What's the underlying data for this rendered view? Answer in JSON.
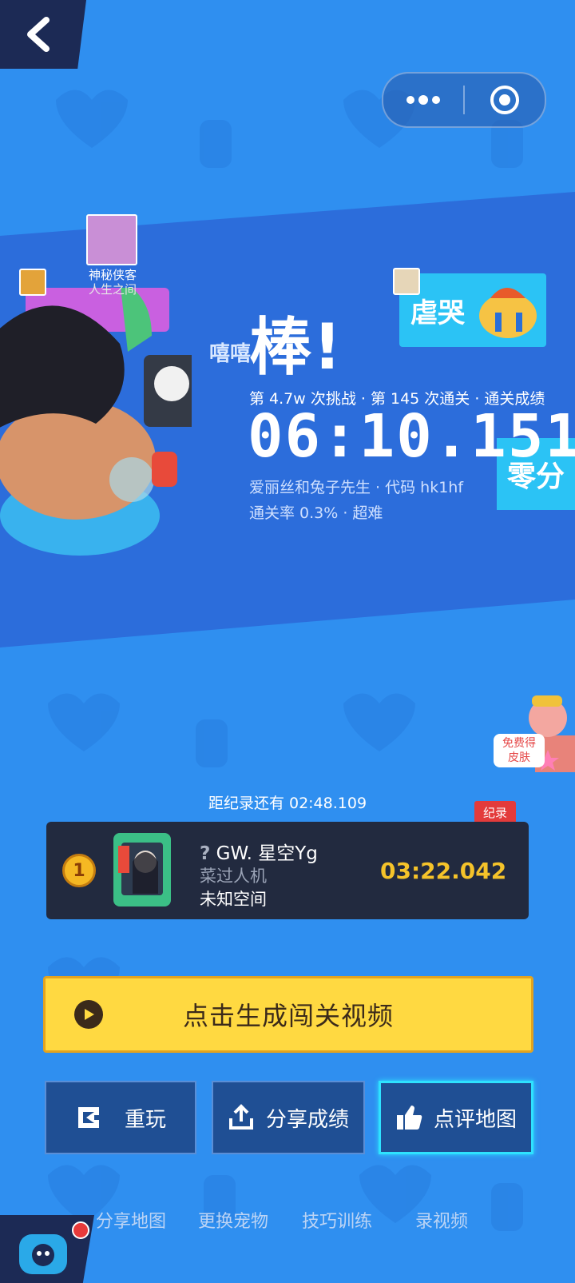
{
  "capsule": {
    "more_icon": "more-dots-icon",
    "close_icon": "target-circle-icon"
  },
  "player_tags": {
    "mystery_name": "神秘侠客",
    "mystery_sub": "人生之间"
  },
  "effects": {
    "laugh": "嘻嘻"
  },
  "result": {
    "title": "棒!",
    "stats": "第 4.7w 次挑战 · 第 145 次通关 · 通关成绩",
    "time": "06:10.151",
    "map_info": "爱丽丝和兔子先生 · 代码 hk1hf",
    "pass_rate": "通关率 0.3% · 超难"
  },
  "badges": {
    "cry": "虐哭",
    "zero": "零分"
  },
  "promo": {
    "free_skin": "免费得\n皮肤"
  },
  "record": {
    "remaining": "距纪录还有 02:48.109",
    "flag": "纪录",
    "rank": "1",
    "name_prefix": "?",
    "name": "GW. 星空Yg",
    "title": "菜过人机",
    "location": "未知空间",
    "time": "03:22.042"
  },
  "actions": {
    "generate_video": "点击生成闯关视频",
    "replay": "重玩",
    "share": "分享成绩",
    "review": "点评地图"
  },
  "bottom_nav": [
    "分享地图",
    "更换宠物",
    "技巧训练",
    "录视频"
  ],
  "colors": {
    "accent": "#ffd941",
    "record_time": "#f5c32a",
    "active_border": "#2ee2ff"
  }
}
